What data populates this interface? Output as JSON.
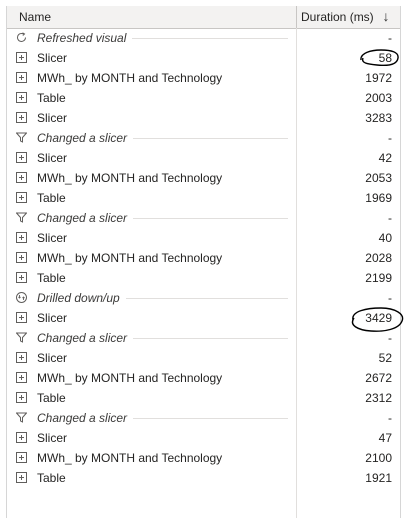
{
  "header": {
    "name_label": "Name",
    "duration_label": "Duration (ms)",
    "sort_icon": "arrow-down-icon"
  },
  "rows": [
    {
      "type": "event",
      "icon": "refresh-icon",
      "label": "Refreshed visual",
      "value": "-"
    },
    {
      "type": "query",
      "icon": "expand-icon",
      "label": "Slicer",
      "value": "58"
    },
    {
      "type": "query",
      "icon": "expand-icon",
      "label": "MWh_ by MONTH and Technology",
      "value": "1972"
    },
    {
      "type": "query",
      "icon": "expand-icon",
      "label": "Table",
      "value": "2003"
    },
    {
      "type": "query",
      "icon": "expand-icon",
      "label": "Slicer",
      "value": "3283"
    },
    {
      "type": "event",
      "icon": "filter-icon",
      "label": "Changed a slicer",
      "value": "-"
    },
    {
      "type": "query",
      "icon": "expand-icon",
      "label": "Slicer",
      "value": "42"
    },
    {
      "type": "query",
      "icon": "expand-icon",
      "label": "MWh_ by MONTH and Technology",
      "value": "2053"
    },
    {
      "type": "query",
      "icon": "expand-icon",
      "label": "Table",
      "value": "1969"
    },
    {
      "type": "event",
      "icon": "filter-icon",
      "label": "Changed a slicer",
      "value": "-"
    },
    {
      "type": "query",
      "icon": "expand-icon",
      "label": "Slicer",
      "value": "40"
    },
    {
      "type": "query",
      "icon": "expand-icon",
      "label": "MWh_ by MONTH and Technology",
      "value": "2028"
    },
    {
      "type": "query",
      "icon": "expand-icon",
      "label": "Table",
      "value": "2199"
    },
    {
      "type": "event",
      "icon": "drill-icon",
      "label": "Drilled down/up",
      "value": "-"
    },
    {
      "type": "query",
      "icon": "expand-icon",
      "label": "Slicer",
      "value": "3429"
    },
    {
      "type": "event",
      "icon": "filter-icon",
      "label": "Changed a slicer",
      "value": "-"
    },
    {
      "type": "query",
      "icon": "expand-icon",
      "label": "Slicer",
      "value": "52"
    },
    {
      "type": "query",
      "icon": "expand-icon",
      "label": "MWh_ by MONTH and Technology",
      "value": "2672"
    },
    {
      "type": "query",
      "icon": "expand-icon",
      "label": "Table",
      "value": "2312"
    },
    {
      "type": "event",
      "icon": "filter-icon",
      "label": "Changed a slicer",
      "value": "-"
    },
    {
      "type": "query",
      "icon": "expand-icon",
      "label": "Slicer",
      "value": "47"
    },
    {
      "type": "query",
      "icon": "expand-icon",
      "label": "MWh_ by MONTH and Technology",
      "value": "2100"
    },
    {
      "type": "query",
      "icon": "expand-icon",
      "label": "Table",
      "value": "1921"
    }
  ],
  "colors": {
    "header_bg": "#f3f2f1",
    "text": "#252423",
    "icon": "#605e5c",
    "annotation": "#000000"
  }
}
